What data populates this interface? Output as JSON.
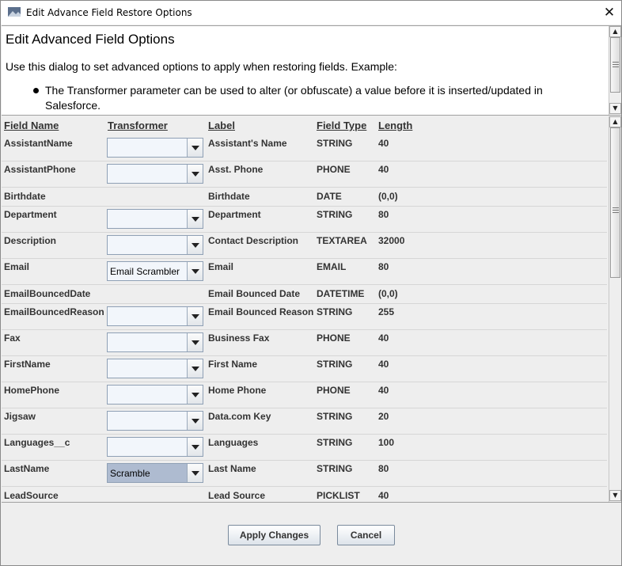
{
  "window": {
    "title": "Edit Advance Field Restore Options",
    "close_icon": "close-icon"
  },
  "description": {
    "heading": "Edit Advanced Field Options",
    "text": "Use this dialog to set advanced options to apply when restoring fields. Example:",
    "bullet": "The Transformer parameter can be used to alter (or obfuscate) a value before it is inserted/updated in Salesforce."
  },
  "table": {
    "headers": {
      "field_name": "Field Name",
      "transformer": "Transformer",
      "label": "Label",
      "field_type": "Field Type",
      "length": "Length"
    },
    "rows": [
      {
        "field": "AssistantName",
        "transformer": "",
        "label": "Assistant's Name",
        "type": "STRING",
        "length": "40"
      },
      {
        "field": "AssistantPhone",
        "transformer": "",
        "label": "Asst. Phone",
        "type": "PHONE",
        "length": "40"
      },
      {
        "field": "Birthdate",
        "label": "Birthdate",
        "type": "DATE",
        "length": "(0,0)"
      },
      {
        "field": "Department",
        "transformer": "",
        "label": "Department",
        "type": "STRING",
        "length": "80"
      },
      {
        "field": "Description",
        "transformer": "",
        "label": "Contact Description",
        "type": "TEXTAREA",
        "length": "32000"
      },
      {
        "field": "Email",
        "transformer": "Email Scrambler",
        "label": "Email",
        "type": "EMAIL",
        "length": "80"
      },
      {
        "field": "EmailBouncedDate",
        "label": "Email Bounced Date",
        "type": "DATETIME",
        "length": "(0,0)"
      },
      {
        "field": "EmailBouncedReason",
        "transformer": "",
        "label": "Email Bounced Reason",
        "type": "STRING",
        "length": "255"
      },
      {
        "field": "Fax",
        "transformer": "",
        "label": "Business Fax",
        "type": "PHONE",
        "length": "40"
      },
      {
        "field": "FirstName",
        "transformer": "",
        "label": "First Name",
        "type": "STRING",
        "length": "40"
      },
      {
        "field": "HomePhone",
        "transformer": "",
        "label": "Home Phone",
        "type": "PHONE",
        "length": "40"
      },
      {
        "field": "Jigsaw",
        "transformer": "",
        "label": "Data.com Key",
        "type": "STRING",
        "length": "20"
      },
      {
        "field": "Languages__c",
        "transformer": "",
        "label": "Languages",
        "type": "STRING",
        "length": "100"
      },
      {
        "field": "LastName",
        "transformer": "Scramble",
        "label": "Last Name",
        "type": "STRING",
        "length": "80"
      },
      {
        "field": "LeadSource",
        "label": "Lead Source",
        "type": "PICKLIST",
        "length": "40"
      }
    ]
  },
  "buttons": {
    "apply": "Apply Changes",
    "cancel": "Cancel"
  },
  "colors": {
    "selected_combo": "#aebbd0",
    "combo_bg": "#f2f6fb"
  }
}
